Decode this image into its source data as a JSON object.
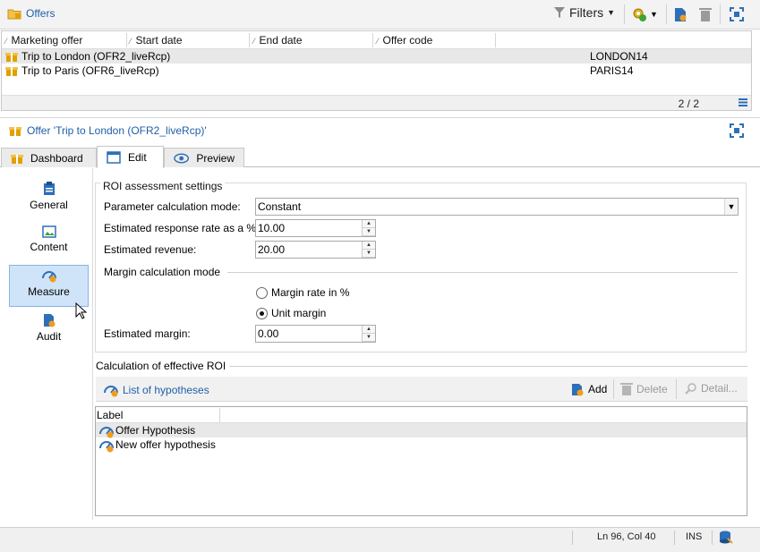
{
  "toolbar": {
    "title": "Offers",
    "filters_label": "Filters"
  },
  "offers_list": {
    "columns": [
      "Marketing offer",
      "Start date",
      "End date",
      "Offer code"
    ],
    "rows": [
      {
        "name": "Trip to London (OFR2_liveRcp)",
        "code": "LONDON14"
      },
      {
        "name": "Trip to Paris (OFR6_liveRcp)",
        "code": "PARIS14"
      }
    ],
    "pagination": "2 / 2"
  },
  "detail": {
    "title": "Offer 'Trip to London (OFR2_liveRcp)'"
  },
  "tabs": [
    {
      "label": "Dashboard"
    },
    {
      "label": "Edit"
    },
    {
      "label": "Preview"
    }
  ],
  "nav": [
    {
      "label": "General"
    },
    {
      "label": "Content"
    },
    {
      "label": "Measure"
    },
    {
      "label": "Audit"
    }
  ],
  "roi": {
    "section_title": "ROI assessment settings",
    "param_mode_label": "Parameter calculation mode:",
    "param_mode_value": "Constant",
    "resp_rate_label": "Estimated response rate as a %:",
    "resp_rate_value": "10.00",
    "revenue_label": "Estimated revenue:",
    "revenue_value": "20.00",
    "margin_mode_title": "Margin calculation mode",
    "radio_rate": "Margin rate in %",
    "radio_unit": "Unit margin",
    "margin_label": "Estimated margin:",
    "margin_value": "0.00"
  },
  "effective": {
    "title": "Calculation of effective ROI",
    "list_title": "List of hypotheses",
    "add": "Add",
    "delete": "Delete",
    "detail": "Detail...",
    "col_label": "Label",
    "rows": [
      "Offer Hypothesis",
      "New offer hypothesis"
    ]
  },
  "status": {
    "pos": "Ln 96, Col 40",
    "mode": "INS"
  },
  "colors": {
    "link": "#1f5fa8",
    "selected_nav": "#cfe4f9",
    "gift_icon": "#e0a100"
  }
}
